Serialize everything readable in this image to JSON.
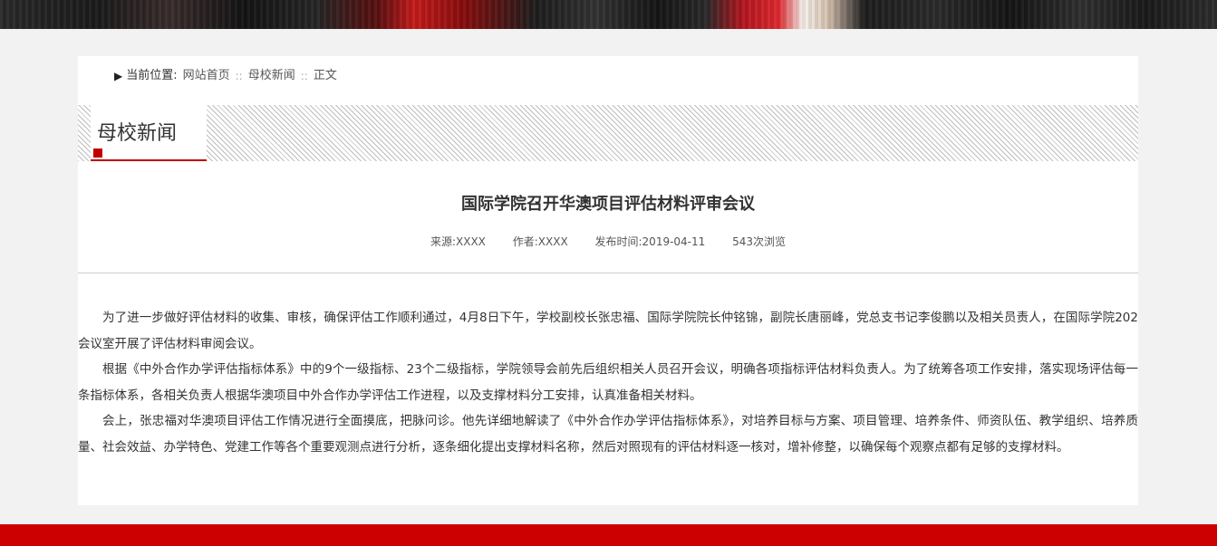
{
  "breadcrumb": {
    "arrow": "▶",
    "label": "当前位置:",
    "items": [
      "网站首页",
      "母校新闻",
      "正文"
    ],
    "separator": "::"
  },
  "section": {
    "title": "母校新闻",
    "accent_color": "#c00000"
  },
  "article": {
    "title": "国际学院召开华澳项目评估材料评审会议",
    "meta": {
      "source": "来源:XXXX",
      "author": "作者:XXXX",
      "published": "发布时间:2019-04-11",
      "views": "543次浏览"
    },
    "paragraphs": [
      "为了进一步做好评估材料的收集、审核，确保评估工作顺利通过，4月8日下午，学校副校长张忠福、国际学院院长仲铭锦，副院长唐丽峰，党总支书记李俊鹏以及相关员责人，在国际学院202会议室开展了评估材料审阅会议。",
      "根据《中外合作办学评估指标体系》中的9个一级指标、23个二级指标，学院领导会前先后组织相关人员召开会议，明确各项指标评估材料负责人。为了统筹各项工作安排，落实现场评估每一条指标体系，各相关负责人根据华澳项目中外合作办学评估工作进程，以及支撑材料分工安排，认真准备相关材料。",
      "会上，张忠福对华澳项目评估工作情况进行全面摸底，把脉问诊。他先详细地解读了《中外合作办学评估指标体系》，对培养目标与方案、项目管理、培养条件、师资队伍、教学组织、培养质量、社会效益、办学特色、党建工作等各个重要观测点进行分析，逐条细化提出支撑材料名称，然后对照现有的评估材料逐一核对，增补修整，以确保每个观察点都有足够的支撑材料。"
    ]
  },
  "footer": {
    "color": "#cc0000"
  }
}
